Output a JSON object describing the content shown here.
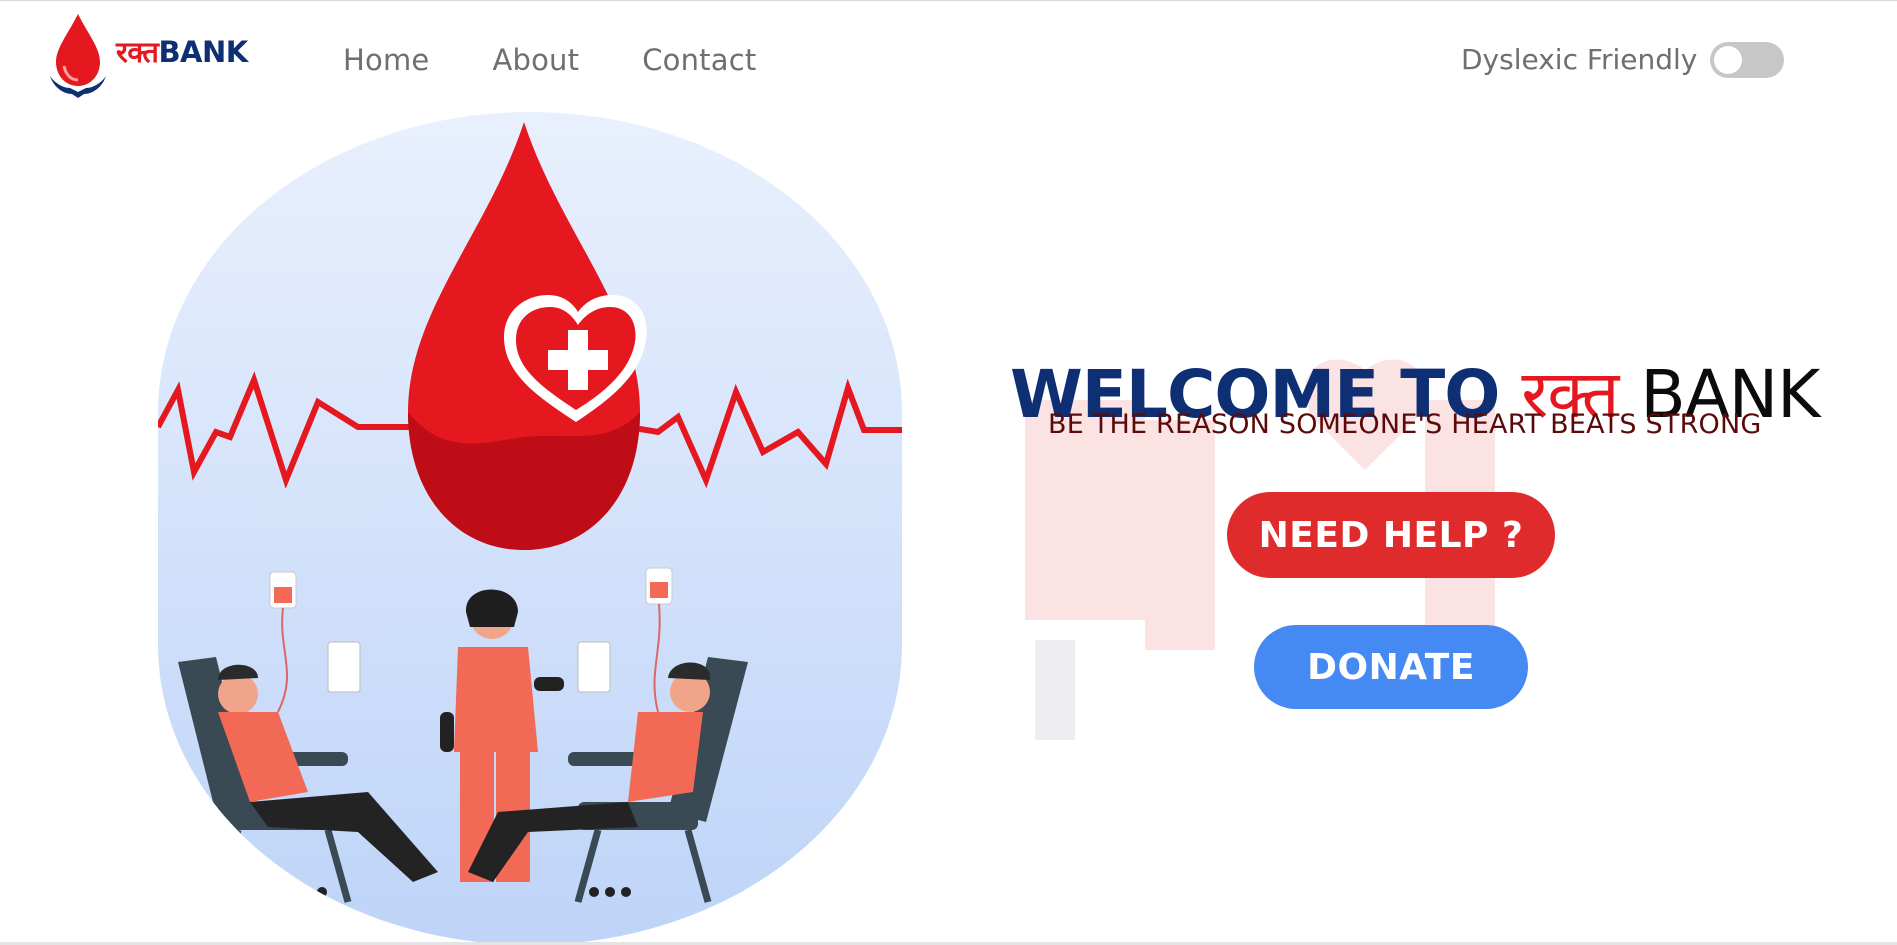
{
  "brand": {
    "devanagari": "रक्त",
    "latin": "BANK",
    "red": "#e5171f",
    "navy": "#0e2f74"
  },
  "nav": {
    "home": "Home",
    "about": "About",
    "contact": "Contact"
  },
  "accessibility": {
    "dyslexic_label": "Dyslexic Friendly",
    "dyslexic_enabled": false
  },
  "hero": {
    "title_part1": "WELCOME TO",
    "title_part2": "रक्त",
    "title_part3": "BANK",
    "tagline": "BE THE REASON SOMEONE'S HEART BEATS STRONG",
    "help_button": "NEED HELP ?",
    "donate_button": "DONATE",
    "help_color": "#e02b2c",
    "donate_color": "#4589f3"
  }
}
